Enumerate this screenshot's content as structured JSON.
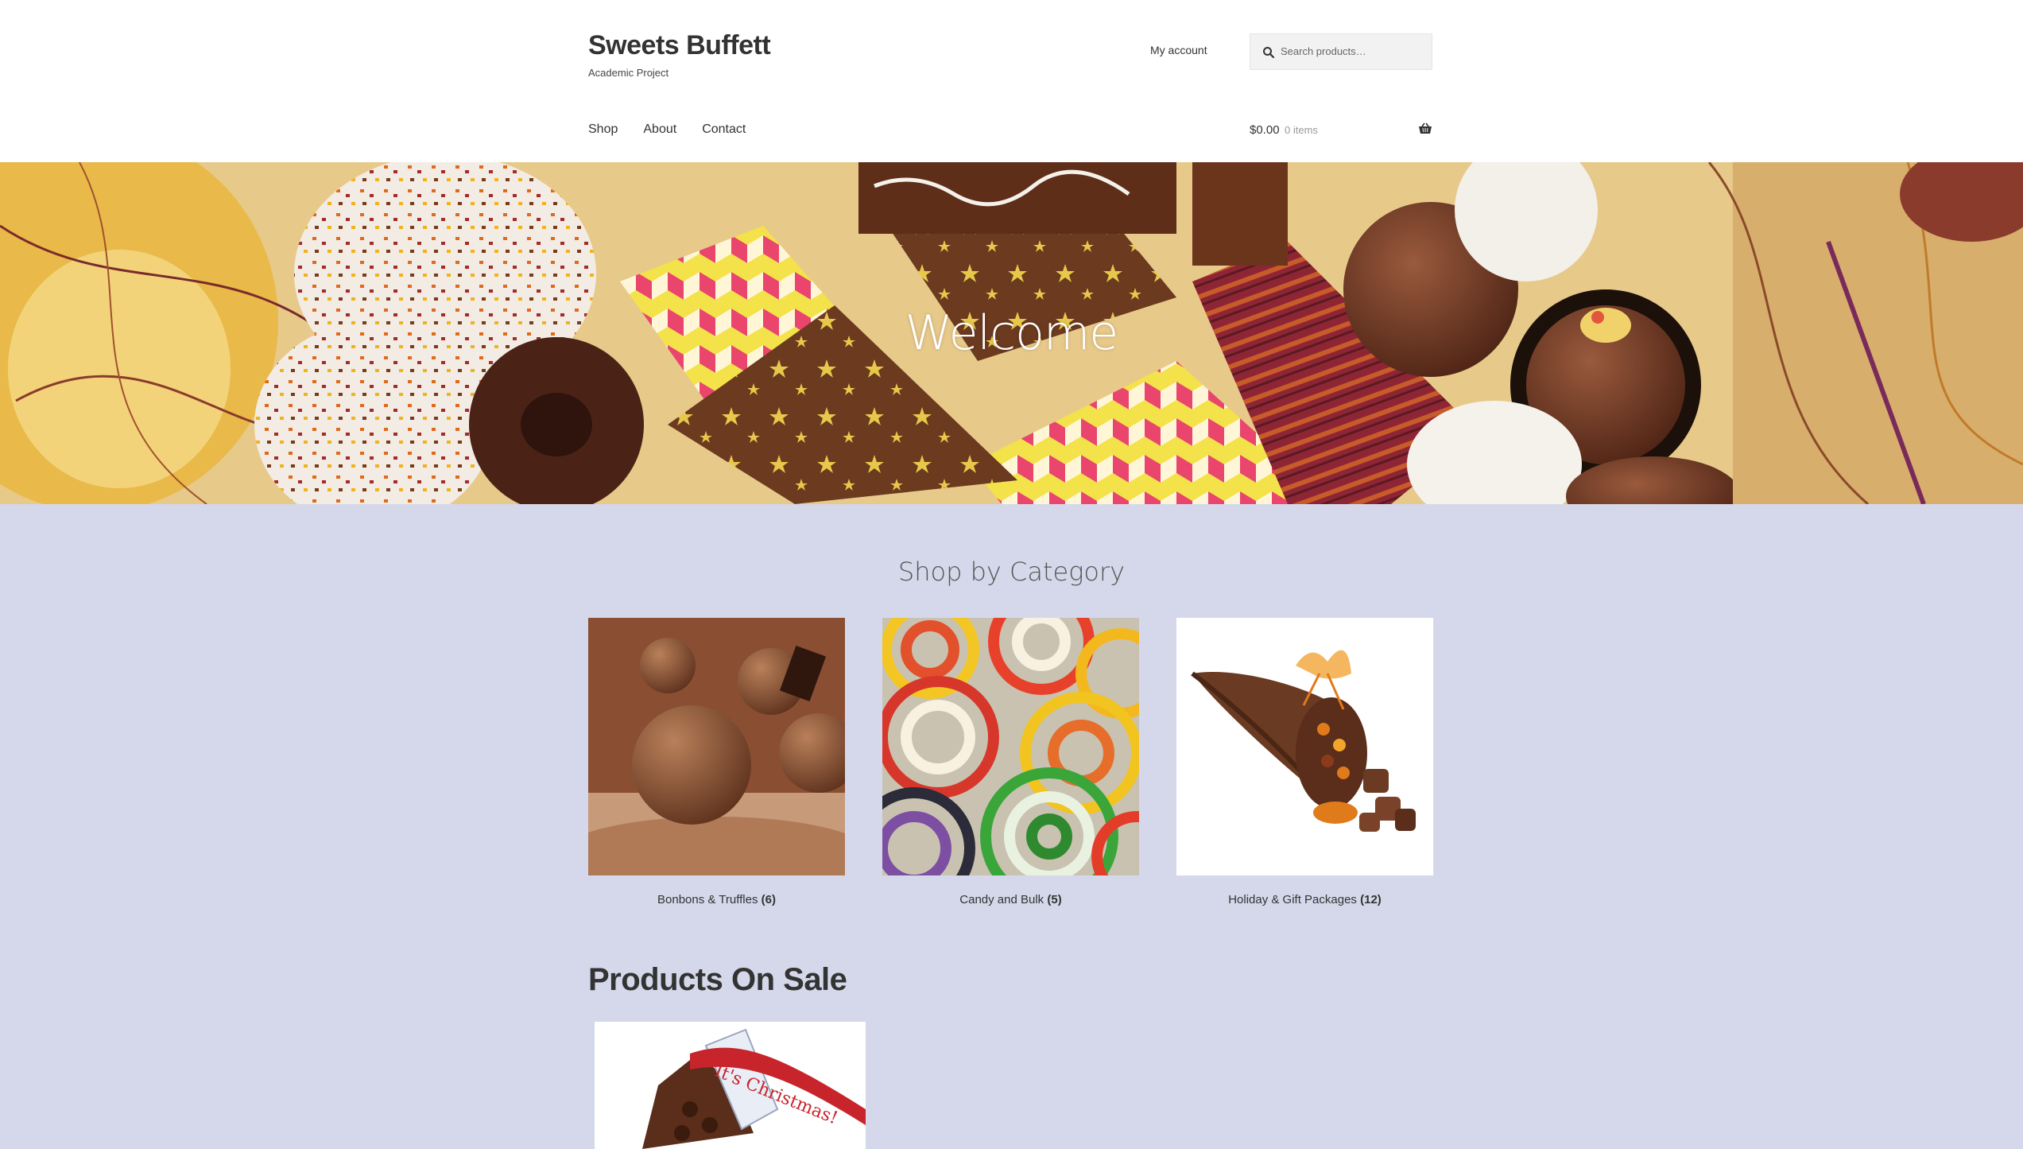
{
  "site": {
    "title": "Sweets Buffett",
    "tagline": "Academic Project"
  },
  "header": {
    "account_link": "My account",
    "search_placeholder": "Search products…",
    "nav": [
      "Shop",
      "About",
      "Contact"
    ],
    "cart": {
      "amount": "$0.00",
      "count": "0 items"
    }
  },
  "hero": {
    "title": "Welcome"
  },
  "categories": {
    "title": "Shop by Category",
    "items": [
      {
        "name": "Bonbons & Truffles",
        "count": "(6)"
      },
      {
        "name": "Candy and Bulk",
        "count": "(5)"
      },
      {
        "name": "Holiday & Gift Packages",
        "count": "(12)"
      }
    ]
  },
  "sale": {
    "title": "Products On Sale",
    "product_label": "It's Christmas!"
  },
  "colors": {
    "page_bg": "#d5d8ea",
    "header_bg": "#ffffff",
    "text": "#333333"
  }
}
